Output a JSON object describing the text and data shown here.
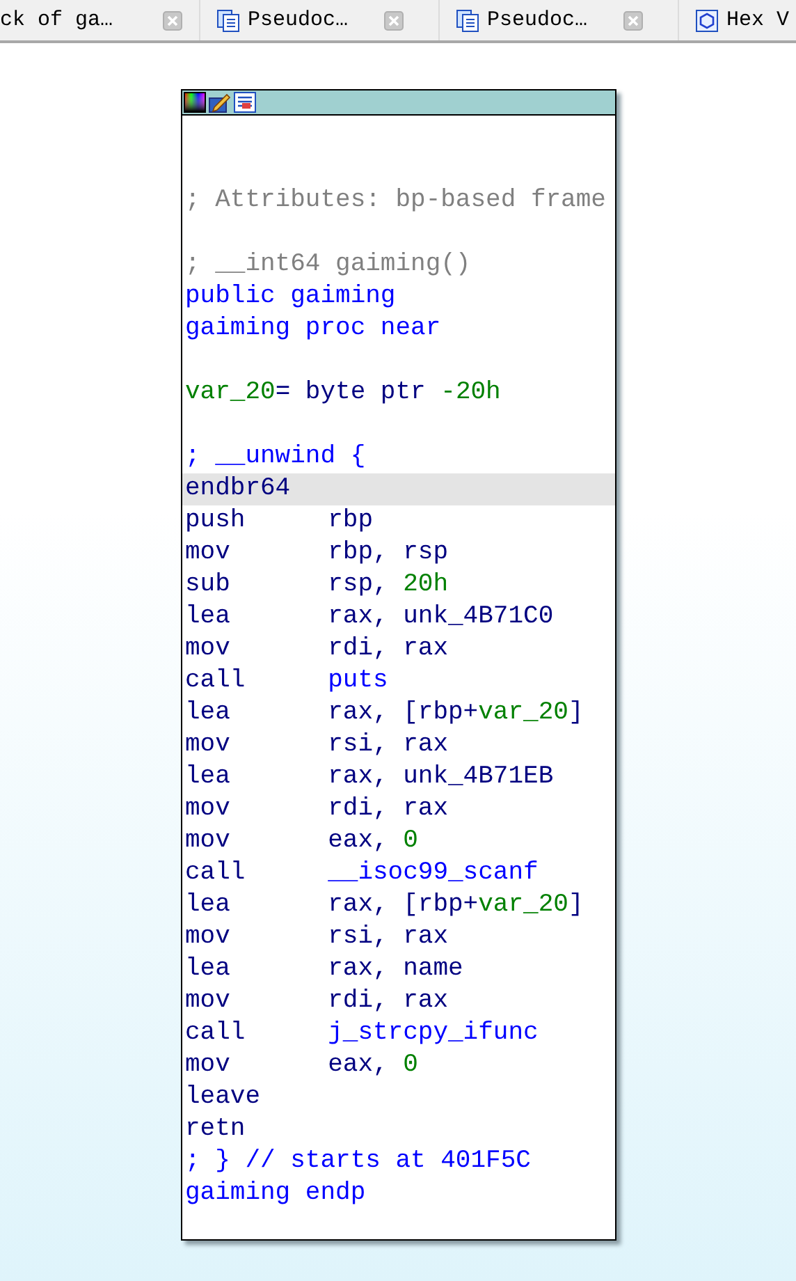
{
  "tabs": [
    {
      "label": "ck of ga…",
      "kind": "plain"
    },
    {
      "label": "Pseudoc…",
      "kind": "document"
    },
    {
      "label": "Pseudoc…",
      "kind": "document"
    },
    {
      "label": "Hex V",
      "kind": "hexview"
    }
  ],
  "graph_node": {
    "lines": [
      {
        "kind": "blank"
      },
      {
        "kind": "blank"
      },
      {
        "kind": "text",
        "tokens": [
          {
            "text": "; Attributes: bp-based frame",
            "kind": "comment"
          }
        ]
      },
      {
        "kind": "blank"
      },
      {
        "kind": "text",
        "tokens": [
          {
            "text": "; __int64 gaiming()",
            "kind": "comment"
          }
        ]
      },
      {
        "kind": "text",
        "tokens": [
          {
            "text": "public gaiming",
            "kind": "keyword"
          }
        ]
      },
      {
        "kind": "text",
        "tokens": [
          {
            "text": "gaiming proc near",
            "kind": "keyword"
          }
        ]
      },
      {
        "kind": "blank"
      },
      {
        "kind": "text",
        "tokens": [
          {
            "text": "var_20",
            "kind": "var"
          },
          {
            "text": "= byte ptr ",
            "kind": "plain"
          },
          {
            "text": "-20h",
            "kind": "number"
          }
        ]
      },
      {
        "kind": "blank"
      },
      {
        "kind": "text",
        "tokens": [
          {
            "text": "; __unwind {",
            "kind": "keyword"
          }
        ]
      },
      {
        "kind": "insn",
        "selected": true,
        "mnemonic": "endbr64"
      },
      {
        "kind": "insn",
        "selected": false,
        "mnemonic": "push",
        "tokens": [
          {
            "text": "rbp",
            "kind": "plain"
          }
        ]
      },
      {
        "kind": "insn",
        "selected": false,
        "mnemonic": "mov",
        "tokens": [
          {
            "text": "rbp, rsp",
            "kind": "plain"
          }
        ]
      },
      {
        "kind": "insn",
        "selected": false,
        "mnemonic": "sub",
        "tokens": [
          {
            "text": "rsp, ",
            "kind": "plain"
          },
          {
            "text": "20h",
            "kind": "number"
          }
        ]
      },
      {
        "kind": "insn",
        "selected": false,
        "mnemonic": "lea",
        "tokens": [
          {
            "text": "rax, unk_4B71C0",
            "kind": "plain"
          }
        ]
      },
      {
        "kind": "insn",
        "selected": false,
        "mnemonic": "mov",
        "tokens": [
          {
            "text": "rdi, rax",
            "kind": "plain"
          }
        ]
      },
      {
        "kind": "insn",
        "selected": false,
        "mnemonic": "call",
        "tokens": [
          {
            "text": "puts",
            "kind": "keyword"
          }
        ]
      },
      {
        "kind": "insn",
        "selected": false,
        "mnemonic": "lea",
        "tokens": [
          {
            "text": "rax, [rbp+",
            "kind": "plain"
          },
          {
            "text": "var_20",
            "kind": "var"
          },
          {
            "text": "]",
            "kind": "plain"
          }
        ]
      },
      {
        "kind": "insn",
        "selected": false,
        "mnemonic": "mov",
        "tokens": [
          {
            "text": "rsi, rax",
            "kind": "plain"
          }
        ]
      },
      {
        "kind": "insn",
        "selected": false,
        "mnemonic": "lea",
        "tokens": [
          {
            "text": "rax, unk_4B71EB",
            "kind": "plain"
          }
        ]
      },
      {
        "kind": "insn",
        "selected": false,
        "mnemonic": "mov",
        "tokens": [
          {
            "text": "rdi, rax",
            "kind": "plain"
          }
        ]
      },
      {
        "kind": "insn",
        "selected": false,
        "mnemonic": "mov",
        "tokens": [
          {
            "text": "eax, ",
            "kind": "plain"
          },
          {
            "text": "0",
            "kind": "number"
          }
        ]
      },
      {
        "kind": "insn",
        "selected": false,
        "mnemonic": "call",
        "tokens": [
          {
            "text": "__isoc99_scanf",
            "kind": "keyword"
          }
        ]
      },
      {
        "kind": "insn",
        "selected": false,
        "mnemonic": "lea",
        "tokens": [
          {
            "text": "rax, [rbp+",
            "kind": "plain"
          },
          {
            "text": "var_20",
            "kind": "var"
          },
          {
            "text": "]",
            "kind": "plain"
          }
        ]
      },
      {
        "kind": "insn",
        "selected": false,
        "mnemonic": "mov",
        "tokens": [
          {
            "text": "rsi, rax",
            "kind": "plain"
          }
        ]
      },
      {
        "kind": "insn",
        "selected": false,
        "mnemonic": "lea",
        "tokens": [
          {
            "text": "rax, name",
            "kind": "plain"
          }
        ]
      },
      {
        "kind": "insn",
        "selected": false,
        "mnemonic": "mov",
        "tokens": [
          {
            "text": "rdi, rax",
            "kind": "plain"
          }
        ]
      },
      {
        "kind": "insn",
        "selected": false,
        "mnemonic": "call",
        "tokens": [
          {
            "text": "j_strcpy_ifunc",
            "kind": "keyword"
          }
        ]
      },
      {
        "kind": "insn",
        "selected": false,
        "mnemonic": "mov",
        "tokens": [
          {
            "text": "eax, ",
            "kind": "plain"
          },
          {
            "text": "0",
            "kind": "number"
          }
        ]
      },
      {
        "kind": "insn",
        "selected": false,
        "mnemonic": "leave"
      },
      {
        "kind": "insn",
        "selected": false,
        "mnemonic": "retn"
      },
      {
        "kind": "text",
        "tokens": [
          {
            "text": "; } // starts at 401F5C",
            "kind": "keyword"
          }
        ]
      },
      {
        "kind": "text",
        "tokens": [
          {
            "text": "gaiming endp",
            "kind": "keyword"
          }
        ]
      }
    ]
  }
}
